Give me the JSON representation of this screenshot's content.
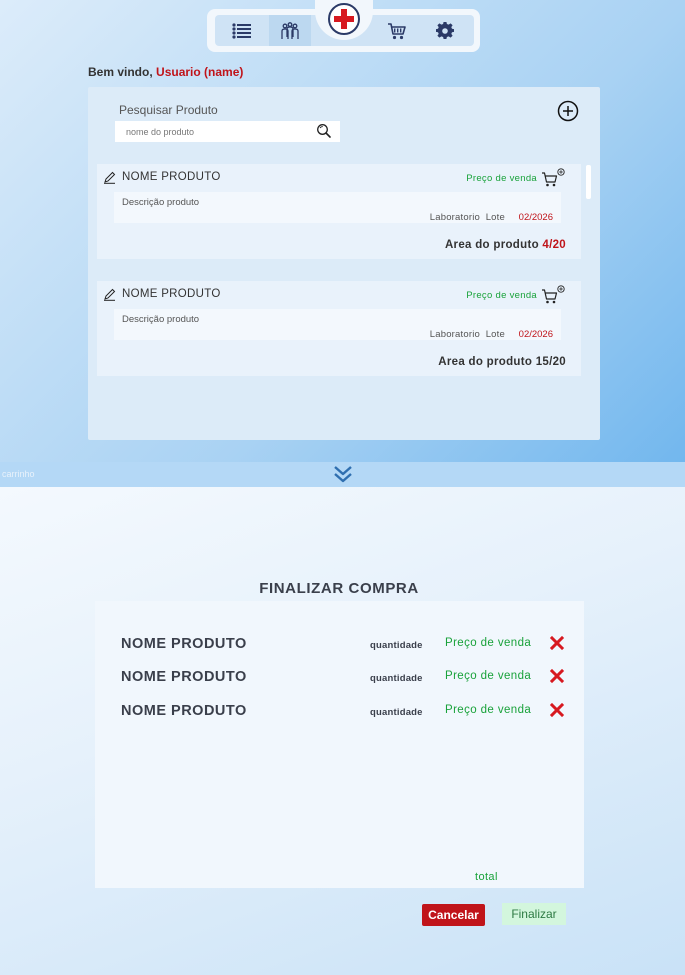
{
  "nav": {
    "items": [
      {
        "icon": "list-icon"
      },
      {
        "icon": "team-icon",
        "selected": true
      },
      {
        "icon": "medical-cross-logo"
      },
      {
        "icon": "cart-icon"
      },
      {
        "icon": "gear-icon"
      }
    ]
  },
  "welcome": {
    "prefix": "Bem vindo,",
    "user": "Usuario (name)"
  },
  "search": {
    "label": "Pesquisar Produto",
    "placeholder": "nome do produto"
  },
  "products": [
    {
      "name": "NOME PRODUTO",
      "price": "Preço de venda",
      "description": "Descrição produto",
      "lab": "Laboratorio",
      "lote": "Lote",
      "expiry": "02/2026",
      "area_label": "Area do produto",
      "area_count": "4/20"
    },
    {
      "name": "NOME PRODUTO",
      "price": "Preço de venda",
      "description": "Descrição produto",
      "lab": "Laboratorio",
      "lote": "Lote",
      "expiry": "02/2026",
      "area_label": "Area do produto",
      "area_count": "15/20"
    }
  ],
  "divider_label": "carrinho",
  "checkout": {
    "title": "FINALIZAR COMPRA",
    "items": [
      {
        "name": "NOME PRODUTO",
        "quantity": "quantidade",
        "price": "Preço de venda"
      },
      {
        "name": "NOME PRODUTO",
        "quantity": "quantidade",
        "price": "Preço de venda"
      },
      {
        "name": "NOME PRODUTO",
        "quantity": "quantidade",
        "price": "Preço de venda"
      }
    ],
    "total": "total",
    "cancel": "Cancelar",
    "finish": "Finalizar"
  },
  "colors": {
    "accent_red": "#c0141a",
    "price_green": "#19a23a",
    "finish_bg": "#d3f6dd"
  }
}
